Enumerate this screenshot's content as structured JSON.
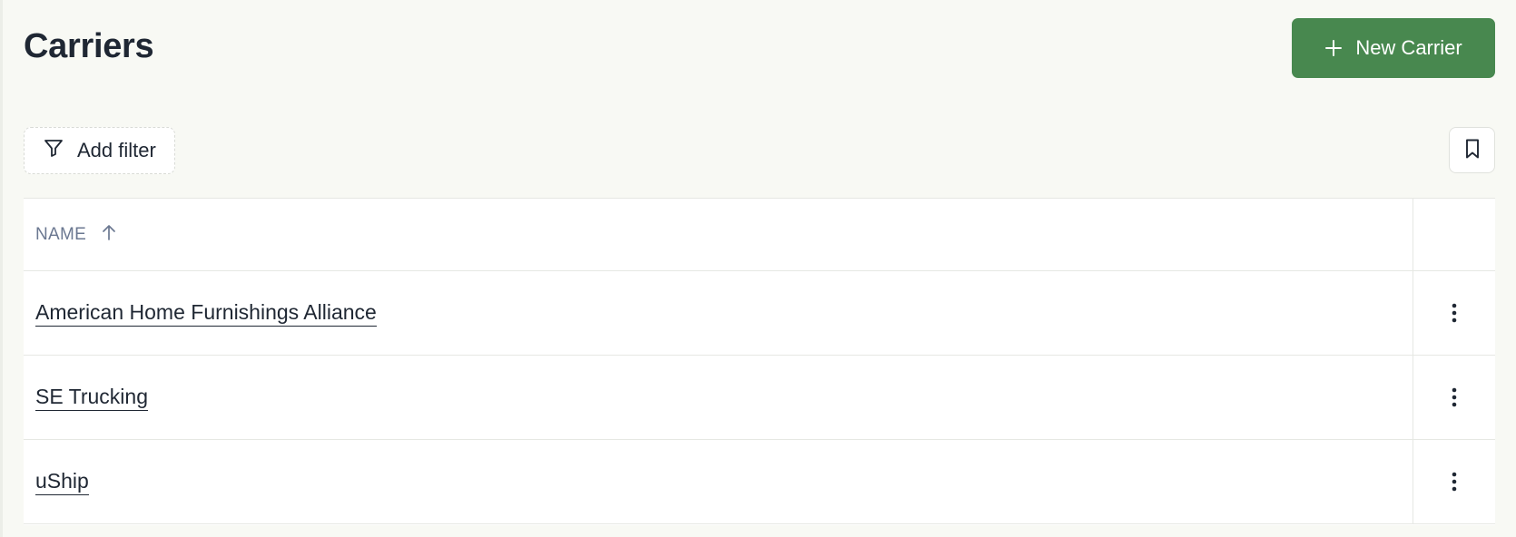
{
  "page": {
    "title": "Carriers"
  },
  "header": {
    "new_button_label": "New Carrier",
    "new_button_icon": "plus-icon"
  },
  "toolbar": {
    "filter_label": "Add filter",
    "filter_icon": "filter-icon",
    "bookmark_icon": "bookmark-icon"
  },
  "table": {
    "columns": [
      {
        "label": "NAME",
        "sort": "ascending",
        "sort_icon": "arrow-up-icon"
      }
    ],
    "rows": [
      {
        "name": "American Home Furnishings Alliance",
        "actions_icon": "more-vertical-icon"
      },
      {
        "name": "SE Trucking",
        "actions_icon": "more-vertical-icon"
      },
      {
        "name": "uShip",
        "actions_icon": "more-vertical-icon"
      }
    ]
  },
  "colors": {
    "primary": "#48884f",
    "background": "#f8f9f4",
    "text": "#1f2733",
    "muted": "#6b7891"
  }
}
